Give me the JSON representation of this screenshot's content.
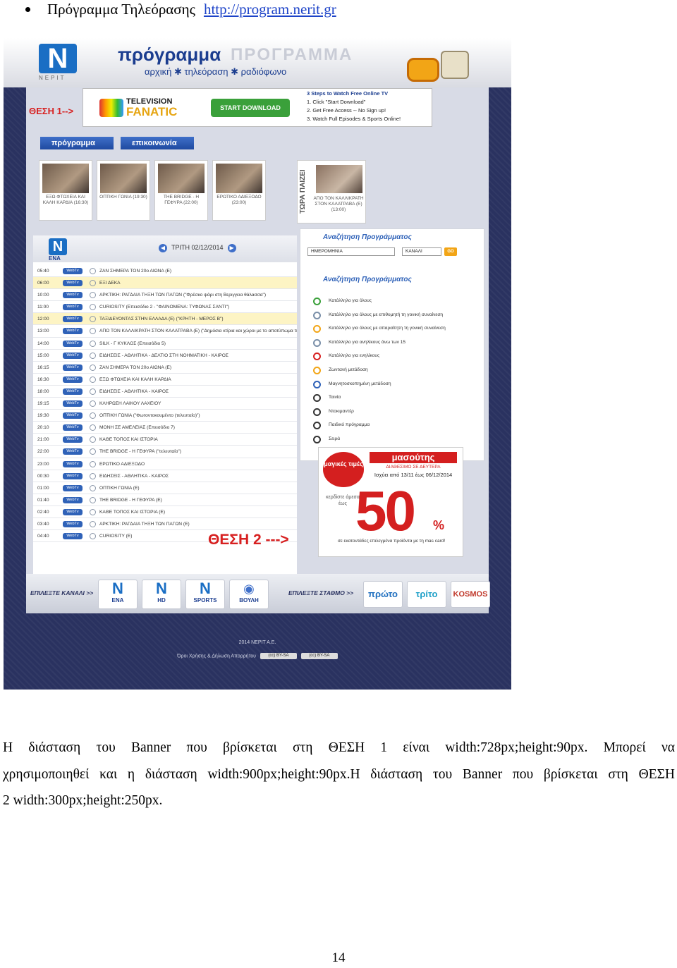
{
  "bullet": {
    "text": "Πρόγραμμα Τηλεόρασης",
    "link": "http://program.nerit.gr"
  },
  "screenshot": {
    "header": {
      "logo": "N",
      "logo_sub": "ΝΕΡΙΤ",
      "title": "πρόγραμμα",
      "title_ghost": "ΠΡΟΓΡΑΜΜΑ",
      "subtitle": "αρχική ✱ τηλεόραση ✱ ραδιόφωνο"
    },
    "position1_label": "ΘΕΣΗ 1-->",
    "banner1": {
      "brand_line1": "TELEVISION",
      "brand_line2": "FANATIC",
      "button": "START DOWNLOAD",
      "steps": [
        "3 Steps to Watch Free Online TV",
        "1. Click \"Start Download\"",
        "2. Get Free Access -- No Sign up!",
        "3. Watch Full Episodes & Sports Online!"
      ]
    },
    "nav": {
      "program": "πρόγραμμα",
      "contact": "επικοινωνία"
    },
    "thumbs": [
      {
        "caption": "ΕΞΩ ΦΤΩΧΕΙΑ ΚΑΙ ΚΑΛΗ ΚΑΡΔΙΑ (16:30)"
      },
      {
        "caption": "ΟΠΤΙΚΗ ΓΩΝΙΑ (19:30)"
      },
      {
        "caption": "THE BRIDGE - Η ΓΕΦΥΡΑ (22:00)"
      },
      {
        "caption": "ΕΡΩΤΙΚΟ ΑΔΙΕΞΟΔΟ (23:00)"
      }
    ],
    "now_playing": {
      "label": "ΤΩΡΑ ΠΑΙΖΕΙ",
      "caption": "ΑΠΟ ΤΟΝ ΚΑΛΛΙΚΡΑΤΗ ΣΤΟΝ ΚΑΛΑΤΡΑΒΑ (Ε) (13:00)"
    },
    "schedule": {
      "channel": "ENA",
      "date": "ΤΡΙΤΗ 02/12/2014",
      "webtv": "WebTv",
      "rows": [
        {
          "time": "05:40",
          "title": "ΖΑΝ ΣΗΜΕΡΑ ΤΟΝ 20ο ΑΙΩΝΑ (Ε)"
        },
        {
          "time": "06:00",
          "title": "ΕΞΙ ΔΕΚΑ"
        },
        {
          "time": "10:00",
          "title": "ΑΡΚΤΙΚΗ: ΡΑΓΔΑΙΑ ΤΗΞΗ ΤΩΝ ΠΑΓΩΝ (\"Φρέσκο ψάρι στη Βεριγγεια θάλασσα\")"
        },
        {
          "time": "11:00",
          "title": "CURIOSITY (Επεισόδιο 2 - \"ΦΑΙΝΟΜΕΝΑ: ΤΥΦΩΝΑΣ ΣΑΝΤΙ\")"
        },
        {
          "time": "12:00",
          "title": "ΤΑΞΙΔΕΥΟΝΤΑΣ ΣΤΗΝ ΕΛΛΑΔΑ (Ε) (\"ΚΡΗΤΗ - ΜΕΡΟΣ Β\")"
        },
        {
          "time": "13:00",
          "title": "ΑΠΟ ΤΟΝ ΚΑΛΛΙΚΡΑΤΗ ΣΤΟΝ ΚΑΛΑΤΡΑΒΑ (Ε) (\"Δημόσια κτίρια και χώροι με το αποτύπωμα της ιστορίας\")"
        },
        {
          "time": "14:00",
          "title": "SILK - Γ ΚΥΚΛΟΣ (Επεισόδιο 5)"
        },
        {
          "time": "15:00",
          "title": "ΕΙΔΗΣΕΙΣ - ΑΘΛΗΤΙΚΑ - ΔΕΛΤΙΟ ΣΤΗ ΝΟΗΜΑΤΙΚΗ - ΚΑΙΡΟΣ"
        },
        {
          "time": "16:15",
          "title": "ΖΑΝ ΣΗΜΕΡΑ ΤΟΝ 20ο ΑΙΩΝΑ (Ε)"
        },
        {
          "time": "16:30",
          "title": "ΕΞΩ ΦΤΩΧΕΙΑ ΚΑΙ ΚΑΛΗ ΚΑΡΔΙΑ"
        },
        {
          "time": "18:00",
          "title": "ΕΙΔΗΣΕΙΣ - ΑΘΛΗΤΙΚΑ - ΚΑΙΡΟΣ"
        },
        {
          "time": "19:15",
          "title": "ΚΛΗΡΩΣΗ ΛΑΙΚΟΥ ΛΑΧΕΙΟΥ"
        },
        {
          "time": "19:30",
          "title": "ΟΠΤΙΚΗ ΓΩΝΙΑ (\"Φωτοντοκουμέντο (τελευταίο)\")"
        },
        {
          "time": "20:10",
          "title": "ΜΟΝΗ ΣΕ ΑΜΕΛΕΙΑΣ (Επεισόδιο 7)"
        },
        {
          "time": "21:00",
          "title": "ΚΑΘΕ ΤΟΠΟΣ ΚΑΙ ΙΣΤΟΡΙΑ"
        },
        {
          "time": "22:00",
          "title": "THE BRIDGE - Η ΓΕΦΥΡΑ (\"τελευταίο\")"
        },
        {
          "time": "23:00",
          "title": "ΕΡΩΤΙΚΟ ΑΔΙΕΞΟΔΟ"
        },
        {
          "time": "00:30",
          "title": "ΕΙΔΗΣΕΙΣ - ΑΘΛΗΤΙΚΑ - ΚΑΙΡΟΣ"
        },
        {
          "time": "01:00",
          "title": "ΟΠΤΙΚΗ ΓΩΝΙΑ (Ε)"
        },
        {
          "time": "01:40",
          "title": "THE BRIDGE - Η ΓΕΦΥΡΑ (Ε)"
        },
        {
          "time": "02:40",
          "title": "ΚΑΘΕ ΤΟΠΟΣ ΚΑΙ ΙΣΤΟΡΙΑ (Ε)"
        },
        {
          "time": "03:40",
          "title": "ΑΡΚΤΙΚΗ: ΡΑΓΔΑΙΑ ΤΗΞΗ ΤΩΝ ΠΑΓΩΝ (Ε)"
        },
        {
          "time": "04:40",
          "title": "CURIOSITY (Ε)"
        }
      ]
    },
    "position2_label": "ΘΕΣΗ 2 --->",
    "search": {
      "title": "Αναζήτηση Προγράμματος",
      "date_select": "ΗΜΕΡΟΜΗΝΙΑ",
      "channel_select": "ΚΑΝΑΛΙ",
      "go": "GO",
      "title2": "Αναζήτηση Προγράμματος",
      "legend": [
        "Κατάλληλο για όλους",
        "Κατάλληλο για όλους με επιθυμητή τη γονική συναίνεση",
        "Κατάλληλο για όλους με απαραίτητη τη γονική συναίνεση",
        "Κατάλληλο για ανηλίκους άνω των 15",
        "Κατάλληλο για ενηλίκους",
        "Ζωντανή μετάδοση",
        "Μαγνητοσκοπημένη μετάδοση",
        "Ταινία",
        "Ντοκιμαντέρ",
        "Παιδικό πρόγραμμα",
        "Σειρά"
      ]
    },
    "ad2": {
      "badge": "μαγικές τιμές",
      "brand": "μασούτης",
      "brand_sub": "ΔΙΑΘΕΣΙΜΟ ΣΕ ΔΕΥΤΕΡΑ",
      "dates": "Ισχύει από 13/11 έως 06/12/2014",
      "left_text": "κερδίστε άμεσα έως",
      "value": "50",
      "percent": "%",
      "foot": "σε εκατοντάδες επιλεγμένα προϊόντα με τη mas card!"
    },
    "channel_bar": {
      "choose_channel": "ΕΠΙΛΕΞΤΕ ΚΑΝΑΛΙ >>",
      "channels": [
        {
          "logo": "N",
          "label": "ENA"
        },
        {
          "logo": "N",
          "label": "HD"
        },
        {
          "logo": "N",
          "label": "SPORTS"
        },
        {
          "logo": "◉",
          "label": "ΒΟΥΛΗ"
        }
      ],
      "choose_station": "ΕΠΙΛΕΞΤΕ ΣΤΑΘΜΟ >>",
      "stations": [
        "πρώτο",
        "τρίτο",
        "KOSMOS"
      ]
    },
    "footer": {
      "copyright": "2014 ΝΕΡΙΤ Α.Ε.",
      "terms": "Όροι Χρήσης & Δήλωση Απορρήτου",
      "cc1": "(cc) BY-SA",
      "cc2": "(cc) BY-SA"
    }
  },
  "paragraph": {
    "line1": "Η διάσταση του Banner που βρίσκεται στη ΘΕΣΗ 1 είναι width:728px;height:90px. Μπορεί να",
    "line2": "χρησιμοποιηθεί και η διάσταση width:900px;height:90px.Η διάσταση του Banner που βρίσκεται στη ΘΕΣΗ",
    "line3": "2 width:300px;height:250px."
  },
  "page_number": "14",
  "colors": {
    "link": "#1d43c8",
    "accent_red": "#d72020",
    "site_blue": "#1b3d8f",
    "site_bg": "#2a3260"
  }
}
